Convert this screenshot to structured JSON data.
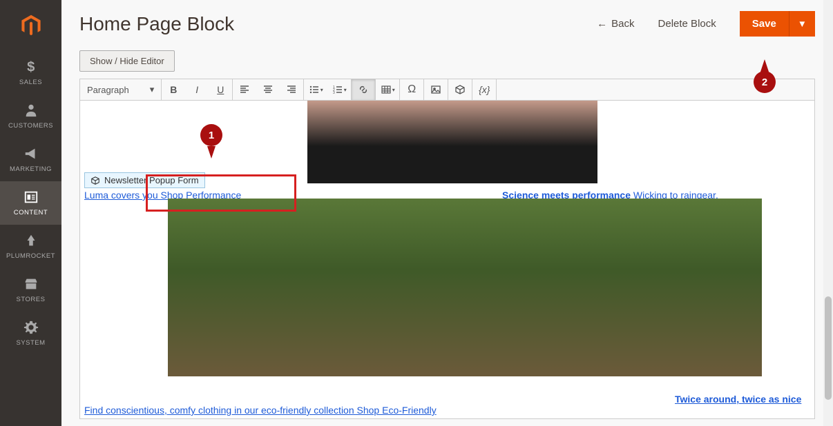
{
  "sidebar": {
    "items": [
      {
        "label": "SALES",
        "icon": "dollar"
      },
      {
        "label": "CUSTOMERS",
        "icon": "person"
      },
      {
        "label": "MARKETING",
        "icon": "megaphone"
      },
      {
        "label": "CONTENT",
        "icon": "content",
        "active": true
      },
      {
        "label": "PLUMROCKET",
        "icon": "plumrocket"
      },
      {
        "label": "STORES",
        "icon": "stores"
      },
      {
        "label": "SYSTEM",
        "icon": "gear"
      }
    ]
  },
  "header": {
    "title": "Home Page Block",
    "back_label": "Back",
    "delete_label": "Delete Block",
    "save_label": "Save"
  },
  "editor": {
    "toggle_label": "Show / Hide Editor",
    "format_dropdown": "Paragraph",
    "widget_label": "Newsletter Popup Form",
    "content_text1_link": "Luma covers you Shop Performance",
    "content_text1_bold": "Science meets performance",
    "content_text1_rest": " Wicking to raingear,",
    "content_text2_bold": "Twice around, twice as nice",
    "content_text2_rest": " Find conscientious, comfy clothing in our eco-friendly collection Shop Eco-Friendly"
  },
  "callouts": {
    "one": "1",
    "two": "2"
  }
}
